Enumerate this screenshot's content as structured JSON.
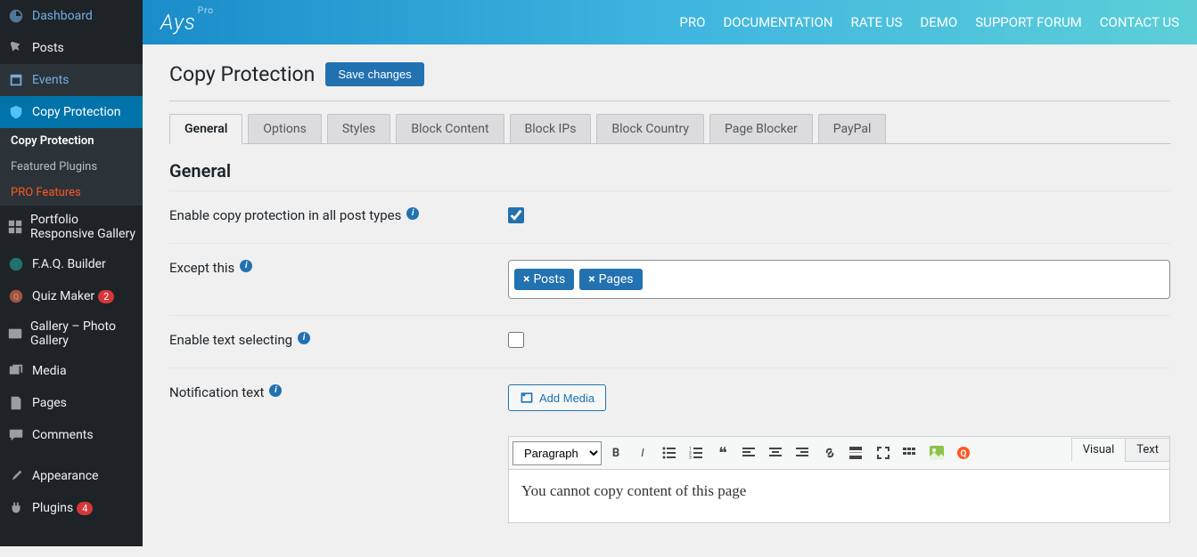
{
  "sidebar": {
    "items": [
      {
        "label": "Dashboard",
        "icon": "dashboard"
      },
      {
        "label": "Posts",
        "icon": "pin"
      },
      {
        "label": "Events",
        "icon": "calendar",
        "highlight": true
      },
      {
        "label": "Copy Protection",
        "icon": "shield",
        "active": true
      },
      {
        "label": "Portfolio Responsive Gallery",
        "icon": "grid"
      },
      {
        "label": "F.A.Q. Builder",
        "icon": "chat"
      },
      {
        "label": "Quiz Maker",
        "icon": "quiz",
        "badge": "2"
      },
      {
        "label": "Gallery – Photo Gallery",
        "icon": "image"
      },
      {
        "label": "Media",
        "icon": "media"
      },
      {
        "label": "Pages",
        "icon": "page"
      },
      {
        "label": "Comments",
        "icon": "comment"
      },
      {
        "label": "Appearance",
        "icon": "brush"
      },
      {
        "label": "Plugins",
        "icon": "plug",
        "badge": "4"
      }
    ],
    "submenu": [
      {
        "label": "Copy Protection",
        "active": true
      },
      {
        "label": "Featured Plugins"
      },
      {
        "label": "PRO Features",
        "highlight": true
      }
    ]
  },
  "topbar": {
    "logo": "Ays",
    "logo_sup": "Pro",
    "nav": [
      "PRO",
      "DOCUMENTATION",
      "RATE US",
      "DEMO",
      "SUPPORT FORUM",
      "CONTACT US"
    ]
  },
  "page": {
    "title": "Copy Protection",
    "save_button": "Save changes"
  },
  "tabs": [
    "General",
    "Options",
    "Styles",
    "Block Content",
    "Block IPs",
    "Block Country",
    "Page Blocker",
    "PayPal"
  ],
  "active_tab": "General",
  "section": {
    "title": "General",
    "enable_all_label": "Enable copy protection in all post types",
    "enable_all_checked": true,
    "except_label": "Except this",
    "except_tags": [
      "Posts",
      "Pages"
    ],
    "enable_text_select_label": "Enable text selecting",
    "enable_text_select_checked": false,
    "notification_label": "Notification text"
  },
  "editor": {
    "add_media": "Add Media",
    "visual_tab": "Visual",
    "text_tab": "Text",
    "format_select": "Paragraph",
    "content": "You cannot copy content of this page"
  }
}
